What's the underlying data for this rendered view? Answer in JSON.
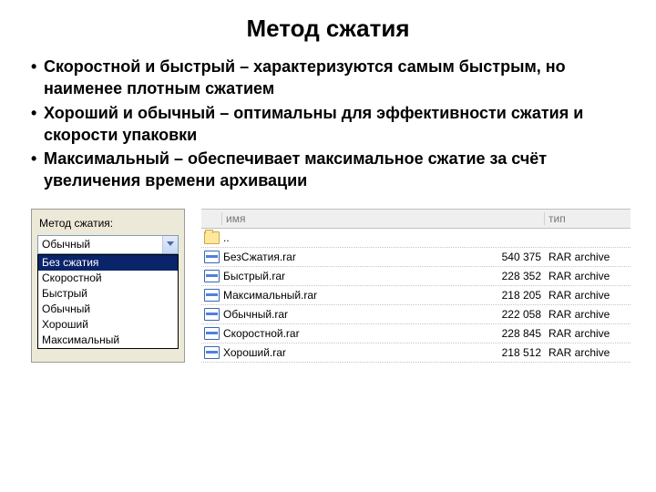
{
  "title": "Метод сжатия",
  "bullets": [
    "Скоростной и быстрый – характеризуются самым быстрым, но наименее плотным сжатием",
    "Хороший и обычный – оптимальны для эффективности сжатия и скорости упаковки",
    "Максимальный – обеспечивает максимальное сжатие за счёт увеличения времени архивации"
  ],
  "combo": {
    "label": "Метод сжатия:",
    "selected": "Обычный",
    "highlighted": "Без сжатия",
    "options_rest": [
      "Скоростной",
      "Быстрый",
      "Обычный",
      "Хороший",
      "Максимальный"
    ]
  },
  "filelist": {
    "header_name_fragment": "имя",
    "header_type_fragment": "тип",
    "parent_row": "..",
    "rows": [
      {
        "name": "БезСжатия.rar",
        "size": "540 375",
        "type": "RAR archive"
      },
      {
        "name": "Быстрый.rar",
        "size": "228 352",
        "type": "RAR archive"
      },
      {
        "name": "Максимальный.rar",
        "size": "218 205",
        "type": "RAR archive"
      },
      {
        "name": "Обычный.rar",
        "size": "222 058",
        "type": "RAR archive"
      },
      {
        "name": "Скоростной.rar",
        "size": "228 845",
        "type": "RAR archive"
      },
      {
        "name": "Хороший.rar",
        "size": "218 512",
        "type": "RAR archive"
      }
    ]
  }
}
